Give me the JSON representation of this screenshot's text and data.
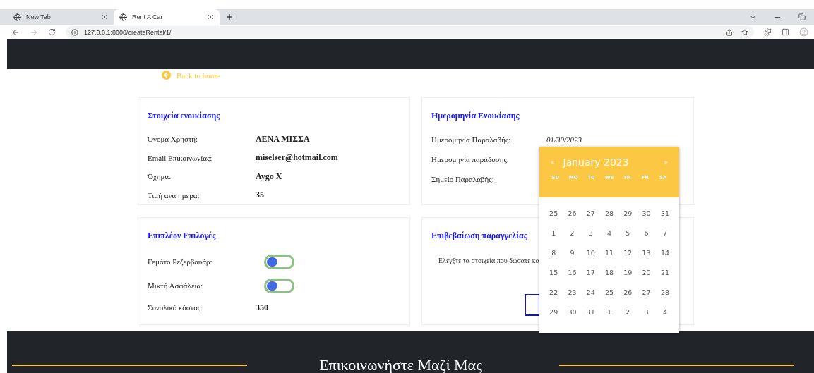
{
  "browser": {
    "tabs": [
      {
        "title": "New Tab",
        "selected": false
      },
      {
        "title": "Rent A Car",
        "selected": true
      }
    ],
    "url": "127.0.0.1:8000/createRental/1/"
  },
  "back_link": "Back to home",
  "rental_details": {
    "title": "Στοιχεία ενοικίασης",
    "rows": [
      {
        "label": "Όνομα Χρήστη:",
        "value": "ΛΕΝΑ ΜΙΣΣΑ"
      },
      {
        "label": "Email Επικοινωνίας:",
        "value": "miselser@hotmail.com"
      },
      {
        "label": "Όχημα:",
        "value": "Aygo X"
      },
      {
        "label": "Τιμή ανα ημέρα:",
        "value": "35"
      }
    ]
  },
  "rental_dates": {
    "title": "Ημερομηνία Ενοικίασης",
    "rows": [
      {
        "label": "Ημερομηνία Παραλαβής:",
        "value": "01/30/2023"
      },
      {
        "label": "Ημερομηνία παράδοσης:"
      },
      {
        "label": "Σημείο Παραλαβής:"
      }
    ]
  },
  "extra_options": {
    "title": "Επιπλέον Επιλογές",
    "toggles": [
      {
        "label": "Γεμάτο Ρεζερβουάρ:",
        "on": false
      },
      {
        "label": "Μικτή Ασφάλεια:",
        "on": false
      }
    ],
    "total": {
      "label": "Συνολικό κόστος:",
      "value": "350"
    }
  },
  "confirmation": {
    "title": "Επιβεβαίωση παραγγελίας",
    "text": "Ελέγξτε τα στοιχεία που δώσατε κα"
  },
  "calendar": {
    "prev": "«",
    "month": "January 2023",
    "next": "»",
    "weekdays": [
      "SU",
      "MO",
      "TU",
      "WE",
      "TH",
      "FR",
      "SA"
    ],
    "days": [
      "25",
      "26",
      "27",
      "28",
      "29",
      "30",
      "31",
      "1",
      "2",
      "3",
      "4",
      "5",
      "6",
      "7",
      "8",
      "9",
      "10",
      "11",
      "12",
      "13",
      "14",
      "15",
      "16",
      "17",
      "18",
      "19",
      "20",
      "21",
      "22",
      "23",
      "24",
      "25",
      "26",
      "27",
      "28",
      "29",
      "30",
      "31",
      "1",
      "2",
      "3",
      "4"
    ]
  },
  "footer": {
    "title": "Επικοινωνήστε Μαζί Μας"
  }
}
